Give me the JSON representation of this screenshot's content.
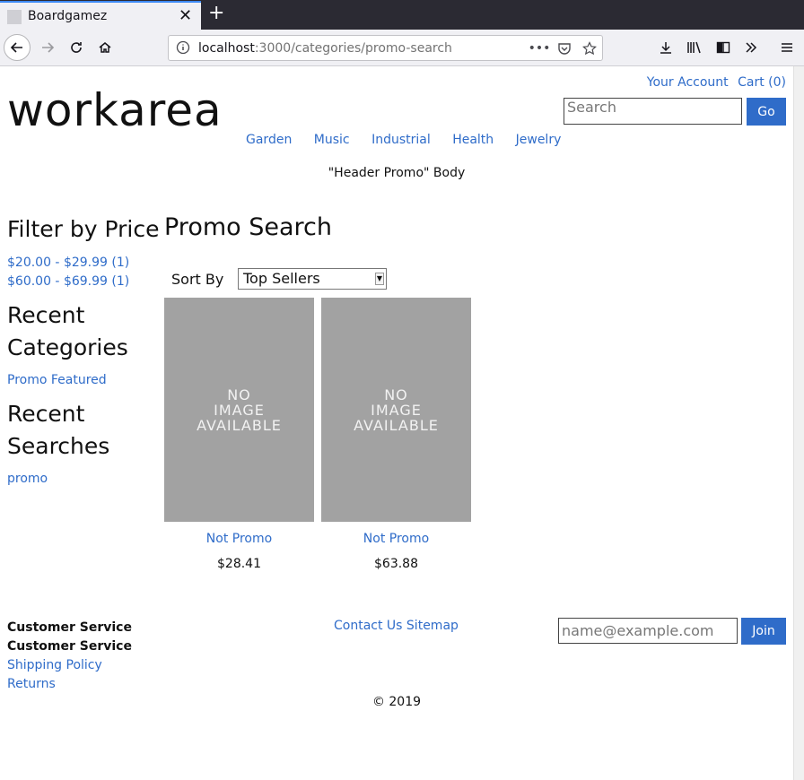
{
  "browser": {
    "tab_title": "Boardgamez",
    "url_host": "localhost",
    "url_path": ":3000/categories/promo-search"
  },
  "header": {
    "logo": "workarea",
    "your_account": "Your Account",
    "cart": "Cart (0)",
    "search_placeholder": "Search",
    "go_label": "Go",
    "nav": [
      "Garden",
      "Music",
      "Industrial",
      "Health",
      "Jewelry"
    ],
    "promo": "\"Header Promo\" Body"
  },
  "sidebar": {
    "filter_heading": "Filter by Price",
    "price_filters": [
      "$20.00 - $29.99 (1)",
      "$60.00 - $69.99 (1)"
    ],
    "recent_categories_heading_1": "Recent",
    "recent_categories_heading_2": "Categories",
    "recent_categories": [
      "Promo Featured"
    ],
    "recent_searches_heading_1": "Recent",
    "recent_searches_heading_2": "Searches",
    "recent_searches": [
      "promo"
    ]
  },
  "main": {
    "title": "Promo Search",
    "sort_label": "Sort By",
    "sort_value": "Top Sellers",
    "products": [
      {
        "image_text_1": "NO",
        "image_text_2": "IMAGE",
        "image_text_3": "AVAILABLE",
        "name": "Not Promo",
        "price": "$28.41"
      },
      {
        "image_text_1": "NO",
        "image_text_2": "IMAGE",
        "image_text_3": "AVAILABLE",
        "name": "Not Promo",
        "price": "$63.88"
      }
    ]
  },
  "footer": {
    "customer_service_1": "Customer Service",
    "customer_service_2": "Customer Service",
    "shipping_policy": "Shipping Policy",
    "returns": "Returns",
    "contact_us": "Contact Us",
    "sitemap": "Sitemap",
    "email_placeholder": "name@example.com",
    "join_label": "Join",
    "copyright": "© 2019"
  }
}
